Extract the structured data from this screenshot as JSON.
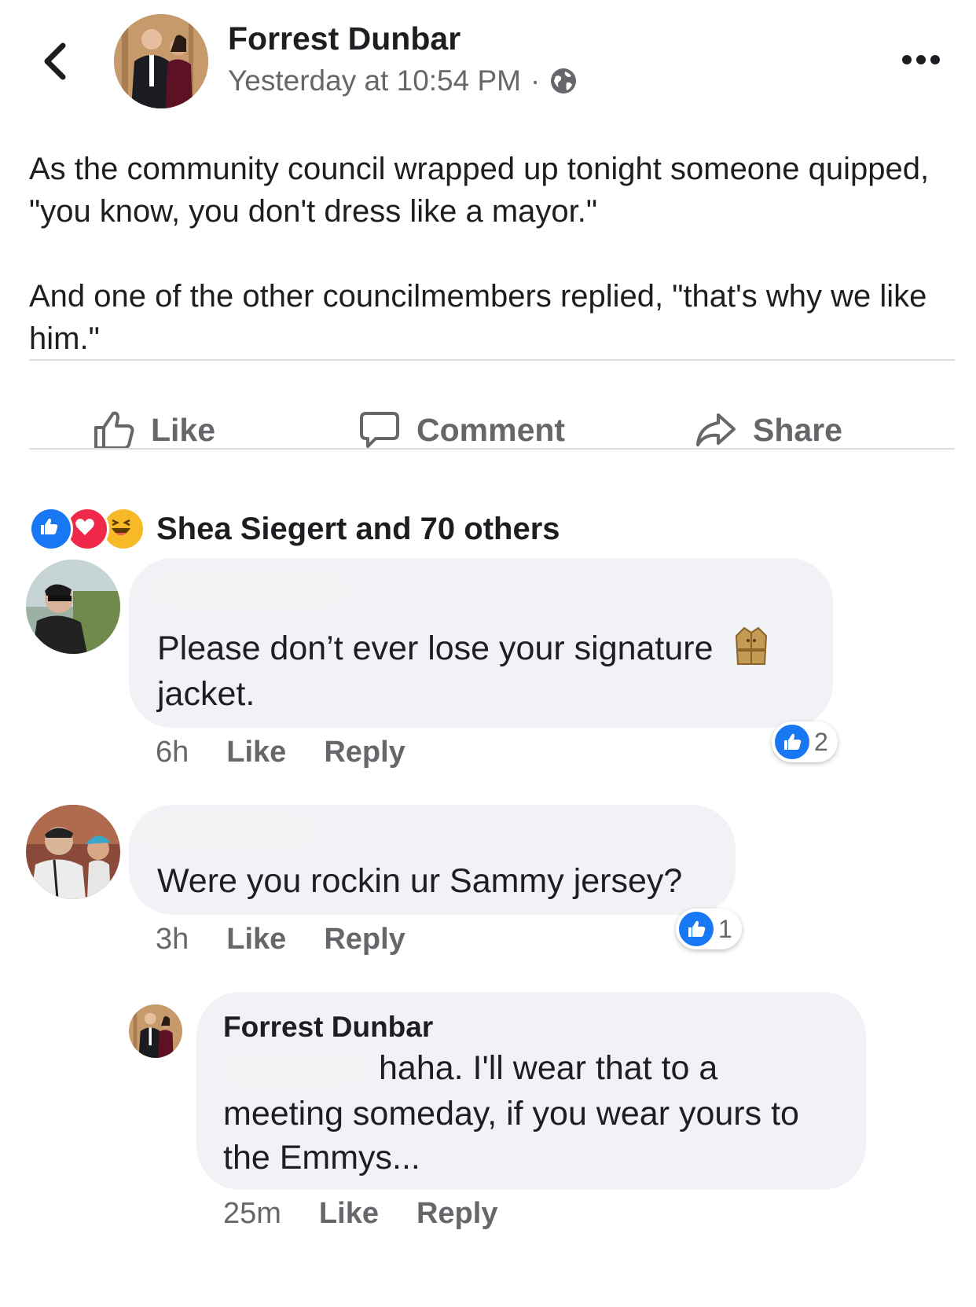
{
  "header": {
    "author_name": "Forrest Dunbar",
    "timestamp": "Yesterday at 10:54 PM",
    "separator": "·",
    "privacy_icon": "globe-icon",
    "back_icon": "chevron-left-icon",
    "more_icon": "more-horizontal-icon"
  },
  "post": {
    "paragraph_1": "As the community council wrapped up tonight someone quipped, \"you know, you don't dress like a mayor.\"",
    "paragraph_2": "And one of the other councilmembers replied, \"that's why we like him.\""
  },
  "actions": {
    "like": "Like",
    "comment": "Comment",
    "share": "Share"
  },
  "reactions": {
    "summary": "Shea Siegert and 70 others",
    "types": [
      "like",
      "love",
      "haha"
    ]
  },
  "comments": [
    {
      "text": "Please don’t ever lose your signature",
      "text_end": "jacket.",
      "emoji": "coat-emoji",
      "time": "6h",
      "like_label": "Like",
      "reply_label": "Reply",
      "like_count": "2"
    },
    {
      "text": "Were you rockin ur Sammy jersey?",
      "time": "3h",
      "like_label": "Like",
      "reply_label": "Reply",
      "like_count": "1"
    }
  ],
  "reply": {
    "author_name": "Forrest Dunbar",
    "text_line1": "haha. I'll wear that to a",
    "text_line2": "meeting someday, if you wear yours to",
    "text_line3": "the Emmys...",
    "time": "25m",
    "like_label": "Like",
    "reply_label": "Reply"
  },
  "colors": {
    "accent_blue": "#1877f2",
    "love_red": "#f02849",
    "haha_yellow": "#f7b928",
    "bubble_bg": "#f0f2f5",
    "secondary_text": "#65676b"
  }
}
